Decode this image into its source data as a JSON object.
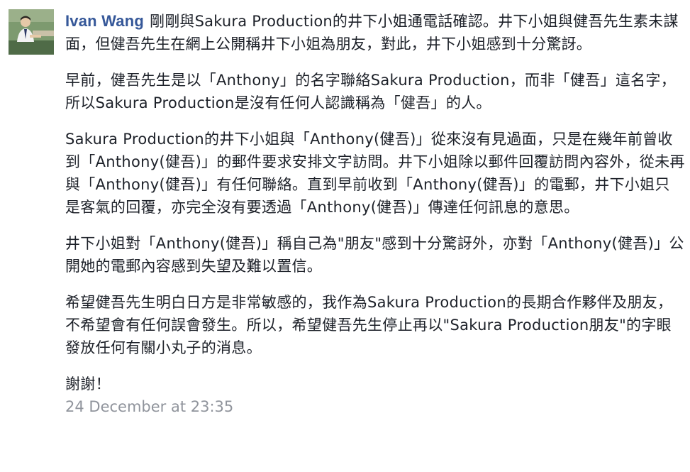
{
  "comment": {
    "author": "Ivan Wang",
    "paragraphs": [
      "剛剛與Sakura Production的井下小姐通電話確認。井下小姐與健吾先生素未謀面，但健吾先生在網上公開稱井下小姐為朋友，對此，井下小姐感到十分驚訝。",
      "早前，健吾先生是以「Anthony」的名字聯絡Sakura Production，而非「健吾」這名字，所以Sakura Production是沒有任何人認識稱為「健吾」的人。",
      "Sakura Production的井下小姐與「Anthony(健吾)」從來沒有見過面，只是在幾年前曾收到「Anthony(健吾)」的郵件要求安排文字訪問。井下小姐除以郵件回覆訪問內容外，從未再與「Anthony(健吾)」有任何聯絡。直到早前收到「Anthony(健吾)」的電郵，井下小姐只是客氣的回覆，亦完全沒有要透過「Anthony(健吾)」傳達任何訊息的意思。",
      "井下小姐對「Anthony(健吾)」稱自己為\"朋友\"感到十分驚訝外，亦對「Anthony(健吾)」公開她的電郵內容感到失望及難以置信。",
      "希望健吾先生明白日方是非常敏感的，我作為Sakura Production的長期合作夥伴及朋友，不希望會有任何誤會發生。所以，希望健吾先生停止再以\"Sakura Production朋友\"的字眼發放任何有關小丸子的消息。",
      "謝謝！"
    ],
    "timestamp": "24 December at 23:35"
  },
  "colors": {
    "author_link": "#365899",
    "body_text": "#1d2129",
    "timestamp": "#90949c"
  }
}
